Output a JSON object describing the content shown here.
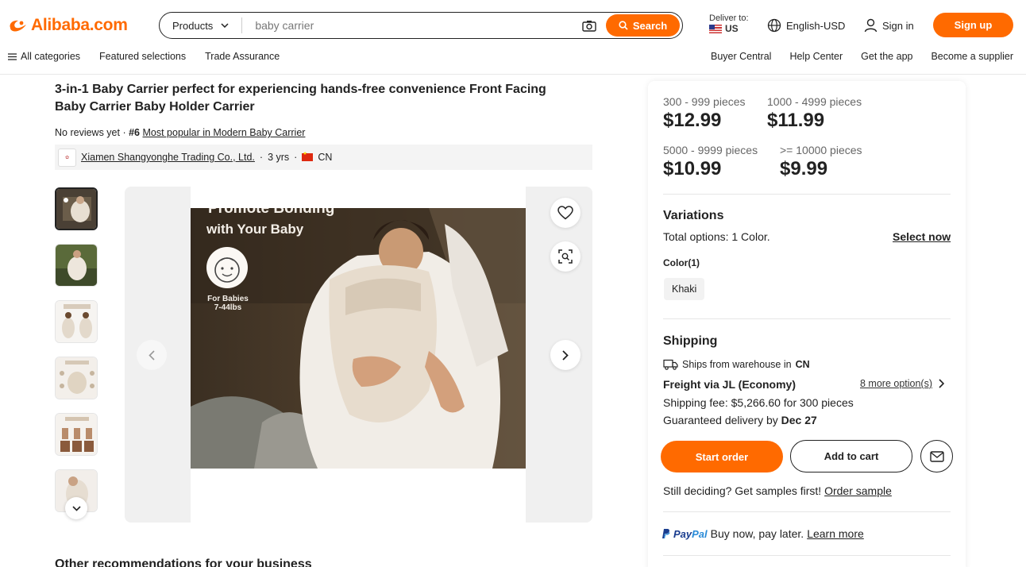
{
  "header": {
    "logo_text": "Alibaba.com",
    "search": {
      "category": "Products",
      "placeholder": "baby carrier",
      "button_label": "Search"
    },
    "deliver_to_label": "Deliver to:",
    "deliver_country": "US",
    "language": "English-USD",
    "sign_in": "Sign in",
    "sign_up": "Sign up"
  },
  "nav": {
    "left": [
      "All categories",
      "Featured selections",
      "Trade Assurance"
    ],
    "right": [
      "Buyer Central",
      "Help Center",
      "Get the app",
      "Become a supplier"
    ]
  },
  "product": {
    "title": "3-in-1 Baby Carrier perfect for experiencing hands-free convenience Front Facing Baby Carrier Baby Holder Carrier",
    "reviews": "No reviews yet",
    "rank": "#6",
    "rank_link": "Most popular in Modern Baby Carrier",
    "supplier": {
      "name": "Xiamen Shangyonghe Trading Co., Ltd.",
      "years": "3 yrs",
      "country": "CN"
    },
    "image_text": {
      "headline": "Promote Bonding",
      "subline": "with Your Baby",
      "badge": "For Babies\n7-44lbs"
    }
  },
  "pricing": {
    "tiers": [
      {
        "qty": "300 - 999 pieces",
        "price": "$12.99"
      },
      {
        "qty": "1000 - 4999 pieces",
        "price": "$11.99"
      },
      {
        "qty": "5000 - 9999 pieces",
        "price": "$10.99"
      },
      {
        "qty": ">= 10000 pieces",
        "price": "$9.99"
      }
    ]
  },
  "variations": {
    "heading": "Variations",
    "total_label": "Total options: 1 Color.",
    "select_now": "Select now",
    "color_label": "Color(1)",
    "colors": [
      "Khaki"
    ]
  },
  "shipping": {
    "heading": "Shipping",
    "ships_from": "Ships from warehouse in",
    "ships_from_country": "CN",
    "method": "Freight via JL (Economy)",
    "more_options": "8 more option(s)",
    "fee": "Shipping fee: $5,266.60 for 300 pieces",
    "delivery_prefix": "Guaranteed delivery by",
    "delivery_date": "Dec 27"
  },
  "actions": {
    "start_order": "Start order",
    "add_to_cart": "Add to cart"
  },
  "samples": {
    "text": "Still deciding? Get samples first!",
    "link": "Order sample"
  },
  "paypal": {
    "brand_a": "Pay",
    "brand_b": "Pal",
    "text": "Buy now, pay later.",
    "link": "Learn more"
  },
  "recommendations_heading": "Other recommendations for your business",
  "colors": {
    "accent": "#ff6a00",
    "text": "#222222"
  }
}
